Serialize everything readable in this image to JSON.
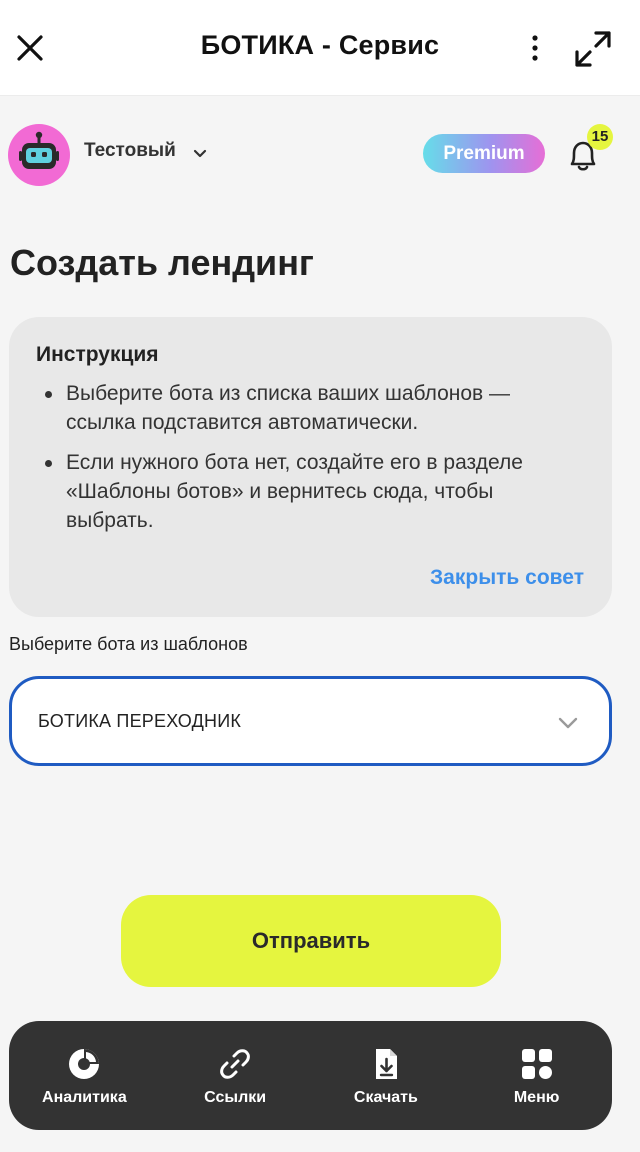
{
  "topbar": {
    "title": "БОТИКА - Сервис",
    "icons": {
      "close": "close-icon",
      "more": "more-vertical-icon",
      "expand": "expand-icon"
    }
  },
  "account": {
    "name": "Тестовый",
    "avatar_icon": "robot-icon",
    "avatar_color": "#f26ad4"
  },
  "premium": {
    "label": "Premium"
  },
  "notifications": {
    "count": "15",
    "badge_color": "#e5f53f"
  },
  "page": {
    "title": "Создать лендинг"
  },
  "tip": {
    "heading": "Инструкция",
    "items": [
      "Выберите бота из списка ваших шаблонов — ссылка подставится автоматически.",
      "Если нужного бота нет, создайте его в разделе «Шаблоны ботов» и вернитесь сюда, чтобы выбрать."
    ],
    "close_label": "Закрыть совет"
  },
  "select": {
    "label": "Выберите бота из шаблонов",
    "value": "БОТИКА ПЕРЕХОДНИК",
    "border_color": "#1f5bc2"
  },
  "submit": {
    "label": "Отправить",
    "color": "#e5f53f"
  },
  "tabbar": {
    "items": [
      {
        "label": "Аналитика",
        "icon": "pie-chart-icon"
      },
      {
        "label": "Ссылки",
        "icon": "link-icon"
      },
      {
        "label": "Скачать",
        "icon": "download-file-icon"
      },
      {
        "label": "Меню",
        "icon": "grid-menu-icon"
      }
    ]
  },
  "colors": {
    "accent": "#3d8fea",
    "background": "#f5f5f5",
    "tabbar": "#333333"
  }
}
